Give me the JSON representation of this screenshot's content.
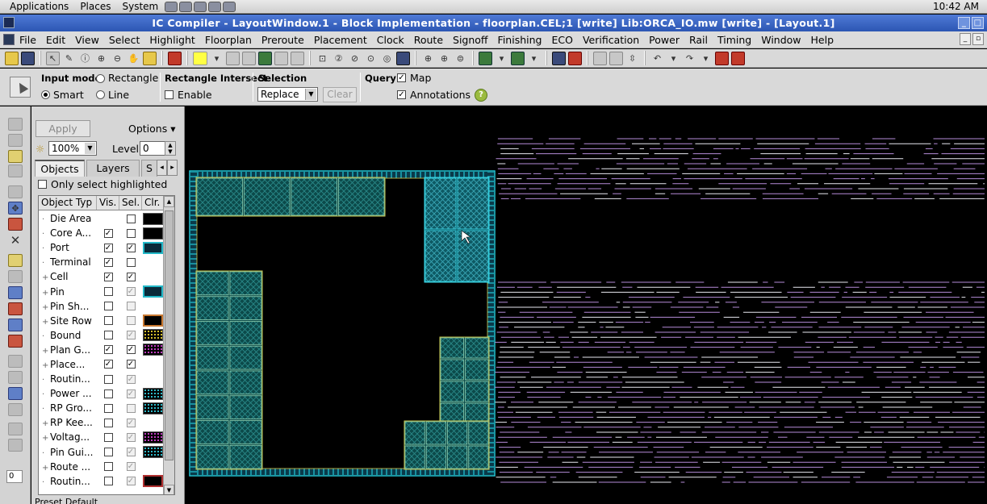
{
  "system_bar": {
    "applications": "Applications",
    "places": "Places",
    "system": "System",
    "clock": "10:42 AM"
  },
  "window": {
    "title": "IC Compiler - LayoutWindow.1 - Block Implementation - floorplan.CEL;1 [write]    Lib:ORCA_IO.mw [write] - [Layout.1]"
  },
  "menu": [
    "File",
    "Edit",
    "View",
    "Select",
    "Highlight",
    "Floorplan",
    "Preroute",
    "Placement",
    "Clock",
    "Route",
    "Signoff",
    "Finishing",
    "ECO",
    "Verification",
    "Power",
    "Rail",
    "Timing",
    "Window",
    "Help"
  ],
  "options": {
    "input_mode_label": "Input mode",
    "rectangle": "Rectangle",
    "smart": "Smart",
    "line": "Line",
    "rect_intersect_label": "Rectangle Intersect",
    "enable": "Enable",
    "selection_label": "Selection",
    "selection_value": "Replace",
    "clear": "Clear",
    "query_label": "Query",
    "map": "Map",
    "annotations": "Annotations",
    "help": "?"
  },
  "panel": {
    "apply": "Apply",
    "options": "Options",
    "zoom": "100%",
    "level_label": "Level",
    "level_value": "0",
    "tabs": [
      "Objects",
      "Layers",
      "S"
    ],
    "only_highlighted": "Only select highlighted",
    "columns": [
      "Object Typ",
      "Vis.",
      "Sel.",
      "Clr."
    ],
    "rows": [
      {
        "name": "Die Area",
        "expand": false,
        "vis": null,
        "sel": false,
        "sel_dis": false,
        "color": "#000000",
        "pattern": "solid"
      },
      {
        "name": "Core A...",
        "expand": false,
        "vis": true,
        "sel": false,
        "sel_dis": false,
        "color": "#000000",
        "pattern": "solid"
      },
      {
        "name": "Port",
        "expand": false,
        "vis": true,
        "sel": true,
        "sel_dis": false,
        "color": "#0a2a3a",
        "pattern": "cyan-border"
      },
      {
        "name": "Terminal",
        "expand": false,
        "vis": true,
        "sel": false,
        "sel_dis": false,
        "color": null,
        "pattern": "none"
      },
      {
        "name": "Cell",
        "expand": true,
        "vis": true,
        "sel": true,
        "sel_dis": false,
        "color": null,
        "pattern": "none"
      },
      {
        "name": "Pin",
        "expand": true,
        "vis": false,
        "sel": true,
        "sel_dis": true,
        "color": "#0a2a3a",
        "pattern": "cyan-border"
      },
      {
        "name": "Pin Sh...",
        "expand": true,
        "vis": false,
        "sel": false,
        "sel_dis": true,
        "color": null,
        "pattern": "none"
      },
      {
        "name": "Site Row",
        "expand": true,
        "vis": false,
        "sel": false,
        "sel_dis": true,
        "color": "#000000",
        "pattern": "orange-border"
      },
      {
        "name": "Bound",
        "expand": false,
        "vis": false,
        "sel": true,
        "sel_dis": true,
        "color": "#000000",
        "pattern": "yellow-dots"
      },
      {
        "name": "Plan G...",
        "expand": true,
        "vis": true,
        "sel": true,
        "sel_dis": false,
        "color": "#000000",
        "pattern": "magenta-dots"
      },
      {
        "name": "Place...",
        "expand": true,
        "vis": true,
        "sel": true,
        "sel_dis": false,
        "color": null,
        "pattern": "none"
      },
      {
        "name": "Routin...",
        "expand": false,
        "vis": false,
        "sel": true,
        "sel_dis": true,
        "color": null,
        "pattern": "none"
      },
      {
        "name": "Power ...",
        "expand": false,
        "vis": false,
        "sel": true,
        "sel_dis": true,
        "color": "#000000",
        "pattern": "cyan-dots"
      },
      {
        "name": "RP Gro...",
        "expand": false,
        "vis": false,
        "sel": false,
        "sel_dis": true,
        "color": "#000000",
        "pattern": "cyan-dots"
      },
      {
        "name": "RP Kee...",
        "expand": true,
        "vis": false,
        "sel": true,
        "sel_dis": true,
        "color": null,
        "pattern": "none"
      },
      {
        "name": "Voltag...",
        "expand": true,
        "vis": false,
        "sel": true,
        "sel_dis": true,
        "color": "#000000",
        "pattern": "magenta-dots"
      },
      {
        "name": "Pin Gui...",
        "expand": false,
        "vis": false,
        "sel": true,
        "sel_dis": true,
        "color": "#000000",
        "pattern": "cyan-dots"
      },
      {
        "name": "Route ...",
        "expand": true,
        "vis": false,
        "sel": true,
        "sel_dis": true,
        "color": null,
        "pattern": "none"
      },
      {
        "name": "Routin...",
        "expand": false,
        "vis": false,
        "sel": true,
        "sel_dis": true,
        "color": "#000000",
        "pattern": "red-border"
      }
    ],
    "preset_label": "Preset",
    "preset_value": "Default"
  },
  "colors": {
    "title_blue": "#2c56b3",
    "macro_fill": "#0c4a4a",
    "macro_border": "#8fd0b0",
    "io_ring": "#22c8d8",
    "selected_macro": "#3ad8e8",
    "std_cell_lines": "#b58bd8"
  }
}
